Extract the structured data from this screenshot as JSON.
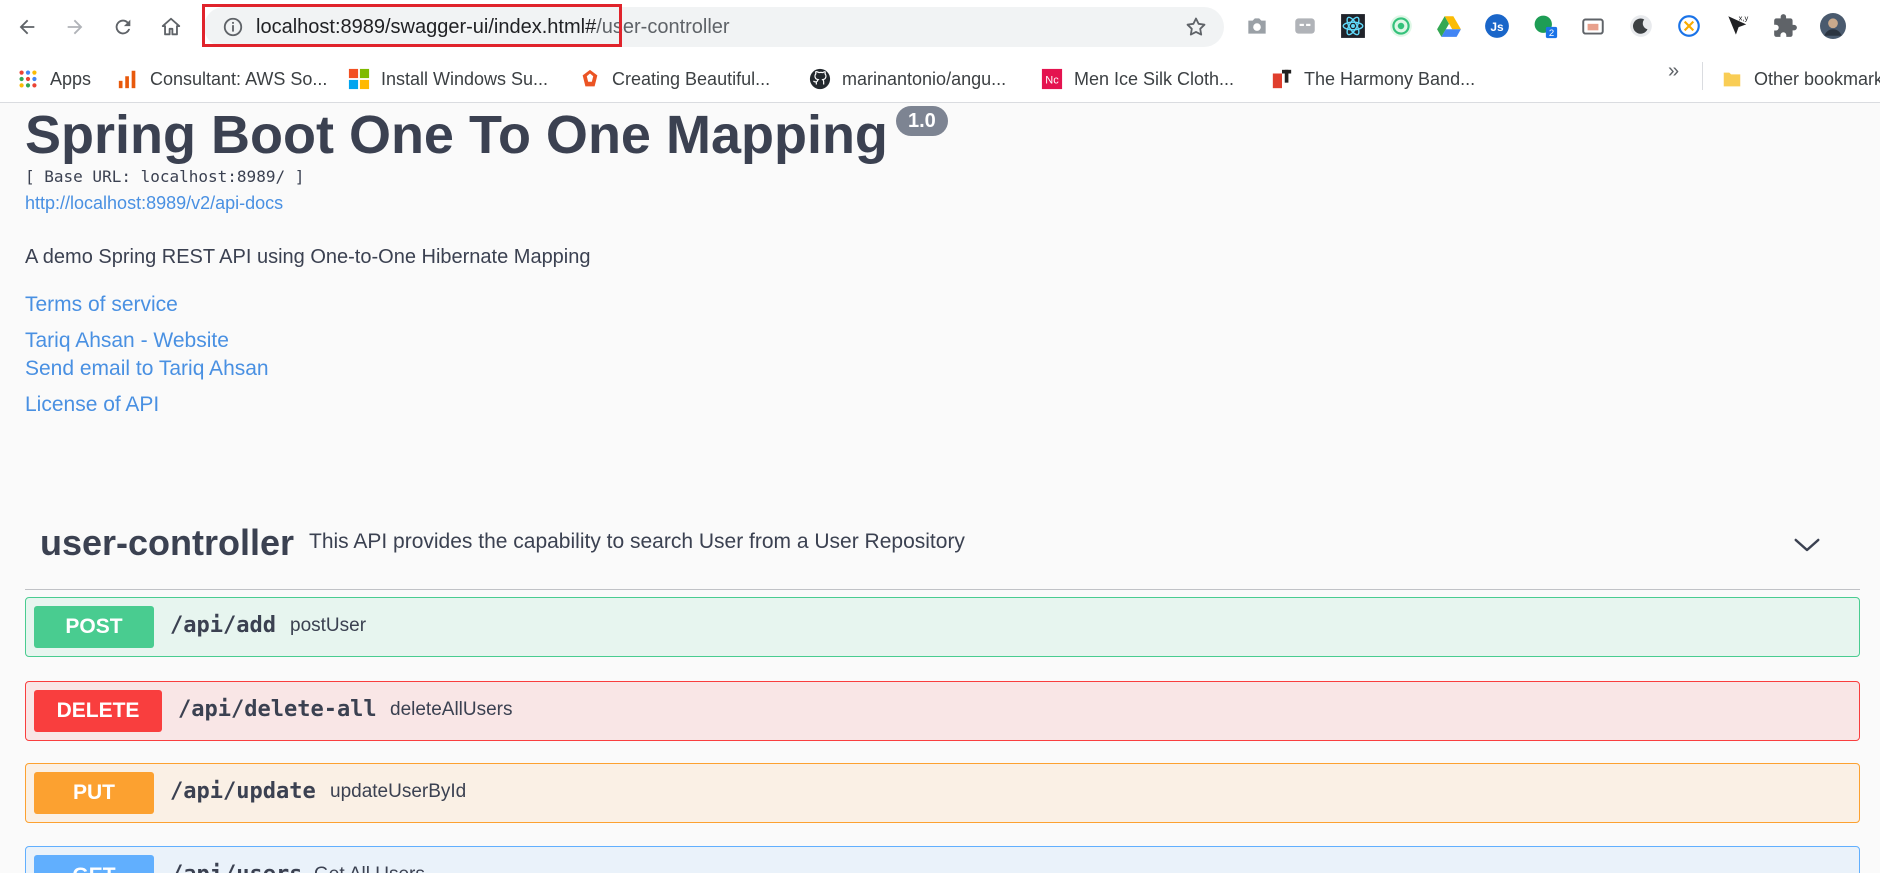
{
  "browser": {
    "url_host": "localhost",
    "url_rest": ":8989/swagger-ui/index.html#",
    "url_hash": "/user-controller",
    "extension_badge": "2",
    "extension_xy": "x,y",
    "extension_js": "Js"
  },
  "bookmarks": {
    "apps": "Apps",
    "items": [
      "Consultant: AWS So...",
      "Install Windows Su...",
      "Creating Beautiful...",
      "marinantonio/angu...",
      "Men Ice Silk Cloth...",
      "The Harmony Band..."
    ],
    "overflow": "»",
    "other": "Other bookmarks"
  },
  "api": {
    "title": "Spring Boot One To One Mapping",
    "version": "1.0",
    "base_url": "[ Base URL: localhost:8989/ ]",
    "docs_link": "http://localhost:8989/v2/api-docs",
    "description": "A demo Spring REST API using One-to-One Hibernate Mapping",
    "terms": "Terms of service",
    "contact_website": "Tariq Ahsan - Website",
    "contact_email": "Send email to Tariq Ahsan",
    "license": "License of API"
  },
  "tag": {
    "name": "user-controller",
    "description": "This API provides the capability to search User from a User Repository"
  },
  "operations": [
    {
      "method": "POST",
      "path": "/api/add",
      "summary": "postUser"
    },
    {
      "method": "DELETE",
      "path": "/api/delete-all",
      "summary": "deleteAllUsers"
    },
    {
      "method": "PUT",
      "path": "/api/update",
      "summary": "updateUserById"
    },
    {
      "method": "GET",
      "path": "/api/users",
      "summary": "Get All Users"
    }
  ],
  "colors": {
    "post": "#49cc90",
    "delete": "#f93e3e",
    "put": "#fca130",
    "get": "#61affe",
    "link": "#4990e2",
    "highlight": "#e0232b"
  }
}
